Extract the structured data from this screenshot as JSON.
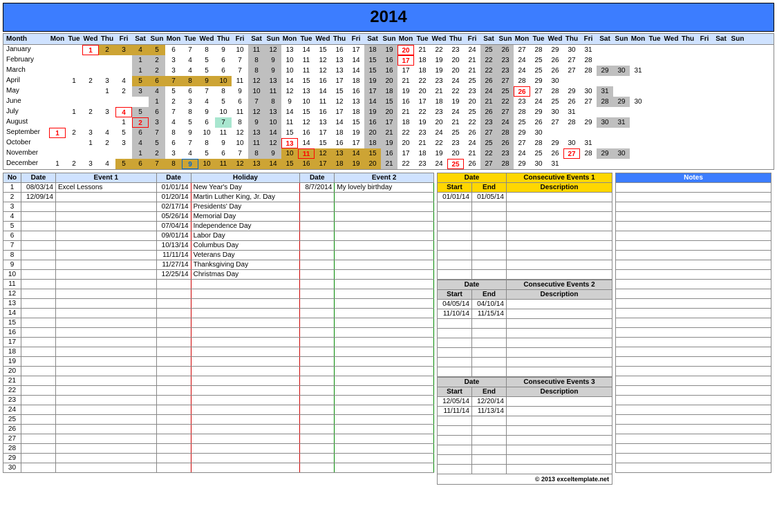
{
  "title": "2014",
  "dayHeaders": [
    "Mon",
    "Tue",
    "Wed",
    "Thu",
    "Fri",
    "Sat",
    "Sun",
    "Mon",
    "Tue",
    "Wed",
    "Thu",
    "Fri",
    "Sat",
    "Sun",
    "Mon",
    "Tue",
    "Wed",
    "Thu",
    "Fri",
    "Sat",
    "Sun",
    "Mon",
    "Tue",
    "Wed",
    "Thu",
    "Fri",
    "Sat",
    "Sun",
    "Mon",
    "Tue",
    "Wed",
    "Thu",
    "Fri",
    "Sat",
    "Sun",
    "Mon",
    "Tue",
    "Wed",
    "Thu",
    "Fri",
    "Sat",
    "Sun"
  ],
  "monthLabel": "Month",
  "months": [
    {
      "name": "January",
      "offset": 2,
      "days": 31,
      "weekend": [
        4,
        5,
        11,
        12,
        18,
        19,
        25,
        26
      ],
      "holiday": [
        1,
        20
      ],
      "mark": [
        1,
        20
      ],
      "ev2": [],
      "hlRange": [
        2,
        5
      ]
    },
    {
      "name": "February",
      "offset": 5,
      "days": 28,
      "weekend": [
        1,
        2,
        8,
        9,
        15,
        16,
        22,
        23
      ],
      "holiday": [
        17
      ],
      "mark": [
        17
      ],
      "ev2": [],
      "hlRange": []
    },
    {
      "name": "March",
      "offset": 5,
      "days": 31,
      "weekend": [
        1,
        2,
        8,
        9,
        15,
        16,
        22,
        23,
        29,
        30
      ],
      "holiday": [],
      "mark": [],
      "ev2": [],
      "hlRange": []
    },
    {
      "name": "April",
      "offset": 1,
      "days": 30,
      "weekend": [
        5,
        6,
        12,
        13,
        19,
        20,
        26,
        27
      ],
      "holiday": [],
      "mark": [],
      "ev2": [
        5,
        6,
        7,
        8,
        9,
        10
      ],
      "hlRange": [
        5,
        10
      ]
    },
    {
      "name": "May",
      "offset": 3,
      "days": 31,
      "weekend": [
        3,
        4,
        10,
        11,
        17,
        18,
        24,
        25,
        31
      ],
      "holiday": [
        26
      ],
      "mark": [
        26
      ],
      "ev2": [],
      "hlRange": []
    },
    {
      "name": "June",
      "offset": 6,
      "days": 30,
      "weekend": [
        1,
        7,
        8,
        14,
        15,
        21,
        22,
        28,
        29
      ],
      "holiday": [],
      "mark": [],
      "ev2": [],
      "hlRange": []
    },
    {
      "name": "July",
      "offset": 1,
      "days": 31,
      "weekend": [
        5,
        6,
        12,
        13,
        19,
        20,
        26,
        27
      ],
      "holiday": [
        4
      ],
      "mark": [
        4
      ],
      "ev2": [],
      "hlRange": []
    },
    {
      "name": "August",
      "offset": 4,
      "days": 31,
      "weekend": [
        2,
        3,
        9,
        10,
        16,
        17,
        23,
        24,
        30,
        31
      ],
      "holiday": [],
      "mark": [
        2
      ],
      "ev2": [
        7
      ],
      "hlRange": []
    },
    {
      "name": "September",
      "offset": 0,
      "days": 30,
      "weekend": [
        6,
        7,
        13,
        14,
        20,
        21,
        27,
        28
      ],
      "holiday": [
        1
      ],
      "mark": [
        1
      ],
      "ev2": [],
      "hlRange": []
    },
    {
      "name": "October",
      "offset": 2,
      "days": 31,
      "weekend": [
        4,
        5,
        11,
        12,
        18,
        19,
        25,
        26
      ],
      "holiday": [
        13
      ],
      "mark": [
        13
      ],
      "ev2": [],
      "hlRange": []
    },
    {
      "name": "November",
      "offset": 5,
      "days": 30,
      "weekend": [
        1,
        2,
        8,
        9,
        15,
        16,
        22,
        23,
        29,
        30
      ],
      "holiday": [
        11,
        27
      ],
      "mark": [
        11,
        27
      ],
      "ev2": [
        10,
        11,
        12,
        13,
        14,
        15
      ],
      "hlRange": [
        10,
        15
      ]
    },
    {
      "name": "December",
      "offset": 0,
      "days": 31,
      "weekend": [
        6,
        7,
        13,
        14,
        20,
        21,
        27,
        28
      ],
      "holiday": [
        25
      ],
      "mark": [
        25
      ],
      "markBlue": [
        9
      ],
      "ev2": [
        5,
        6,
        7,
        8,
        9,
        10,
        11,
        12,
        13,
        14,
        15,
        16,
        17,
        18,
        19,
        20
      ],
      "hlRange": [
        5,
        20
      ]
    }
  ],
  "eventTable": {
    "headers": {
      "no": "No",
      "date": "Date",
      "event1": "Event 1",
      "hdate": "Date",
      "holiday": "Holiday",
      "edate": "Date",
      "event2": "Event 2"
    },
    "rows": [
      {
        "no": "1",
        "date": "08/03/14",
        "event": "Excel Lessons",
        "hdate": "01/01/14",
        "holiday": "New Year's Day",
        "edate": "8/7/2014",
        "event2": "My lovely birthday"
      },
      {
        "no": "2",
        "date": "12/09/14",
        "event": "",
        "hdate": "01/20/14",
        "holiday": "Martin Luther King, Jr. Day",
        "edate": "",
        "event2": ""
      },
      {
        "no": "3",
        "date": "",
        "event": "",
        "hdate": "02/17/14",
        "holiday": "Presidents' Day",
        "edate": "",
        "event2": ""
      },
      {
        "no": "4",
        "date": "",
        "event": "",
        "hdate": "05/26/14",
        "holiday": "Memorial Day",
        "edate": "",
        "event2": ""
      },
      {
        "no": "5",
        "date": "",
        "event": "",
        "hdate": "07/04/14",
        "holiday": "Independence Day",
        "edate": "",
        "event2": ""
      },
      {
        "no": "6",
        "date": "",
        "event": "",
        "hdate": "09/01/14",
        "holiday": "Labor Day",
        "edate": "",
        "event2": ""
      },
      {
        "no": "7",
        "date": "",
        "event": "",
        "hdate": "10/13/14",
        "holiday": "Columbus Day",
        "edate": "",
        "event2": ""
      },
      {
        "no": "8",
        "date": "",
        "event": "",
        "hdate": "11/11/14",
        "holiday": "Veterans Day",
        "edate": "",
        "event2": ""
      },
      {
        "no": "9",
        "date": "",
        "event": "",
        "hdate": "11/27/14",
        "holiday": "Thanksgiving Day",
        "edate": "",
        "event2": ""
      },
      {
        "no": "10",
        "date": "",
        "event": "",
        "hdate": "12/25/14",
        "holiday": "Christmas Day",
        "edate": "",
        "event2": ""
      },
      {
        "no": "11"
      },
      {
        "no": "12"
      },
      {
        "no": "13"
      },
      {
        "no": "14"
      },
      {
        "no": "15"
      },
      {
        "no": "16"
      },
      {
        "no": "17"
      },
      {
        "no": "18"
      },
      {
        "no": "19"
      },
      {
        "no": "20"
      },
      {
        "no": "21"
      },
      {
        "no": "22"
      },
      {
        "no": "23"
      },
      {
        "no": "24"
      },
      {
        "no": "25"
      },
      {
        "no": "26"
      },
      {
        "no": "27"
      },
      {
        "no": "28"
      },
      {
        "no": "29"
      },
      {
        "no": "30"
      }
    ]
  },
  "consec": [
    {
      "style": "yellow",
      "headers": {
        "date": "Date",
        "consec": "Consecutive Events 1",
        "start": "Start",
        "end": "End",
        "desc": "Description"
      },
      "rows": [
        {
          "start": "01/01/14",
          "end": "01/05/14",
          "desc": ""
        },
        {
          "start": "",
          "end": "",
          "desc": ""
        },
        {
          "start": "",
          "end": "",
          "desc": ""
        },
        {
          "start": "",
          "end": "",
          "desc": ""
        },
        {
          "start": "",
          "end": "",
          "desc": ""
        },
        {
          "start": "",
          "end": "",
          "desc": ""
        },
        {
          "start": "",
          "end": "",
          "desc": ""
        },
        {
          "start": "",
          "end": "",
          "desc": ""
        },
        {
          "start": "",
          "end": "",
          "desc": ""
        }
      ]
    },
    {
      "style": "gray",
      "headers": {
        "date": "Date",
        "consec": "Consecutive Events 2",
        "start": "Start",
        "end": "End",
        "desc": "Description"
      },
      "rows": [
        {
          "start": "04/05/14",
          "end": "04/10/14",
          "desc": ""
        },
        {
          "start": "11/10/14",
          "end": "11/15/14",
          "desc": ""
        },
        {
          "start": "",
          "end": "",
          "desc": ""
        },
        {
          "start": "",
          "end": "",
          "desc": ""
        },
        {
          "start": "",
          "end": "",
          "desc": ""
        },
        {
          "start": "",
          "end": "",
          "desc": ""
        },
        {
          "start": "",
          "end": "",
          "desc": ""
        },
        {
          "start": "",
          "end": "",
          "desc": ""
        }
      ]
    },
    {
      "style": "gray",
      "headers": {
        "date": "Date",
        "consec": "Consecutive Events 3",
        "start": "Start",
        "end": "End",
        "desc": "Description"
      },
      "rows": [
        {
          "start": "12/05/14",
          "end": "12/20/14",
          "desc": ""
        },
        {
          "start": "11/11/14",
          "end": "11/13/14",
          "desc": ""
        },
        {
          "start": "",
          "end": "",
          "desc": ""
        },
        {
          "start": "",
          "end": "",
          "desc": ""
        },
        {
          "start": "",
          "end": "",
          "desc": ""
        },
        {
          "start": "",
          "end": "",
          "desc": ""
        },
        {
          "start": "",
          "end": "",
          "desc": ""
        },
        {
          "start": "",
          "end": "",
          "desc": ""
        }
      ]
    }
  ],
  "notesHeader": "Notes",
  "notesRows": 30,
  "footer": "© 2013 exceltemplate.net"
}
